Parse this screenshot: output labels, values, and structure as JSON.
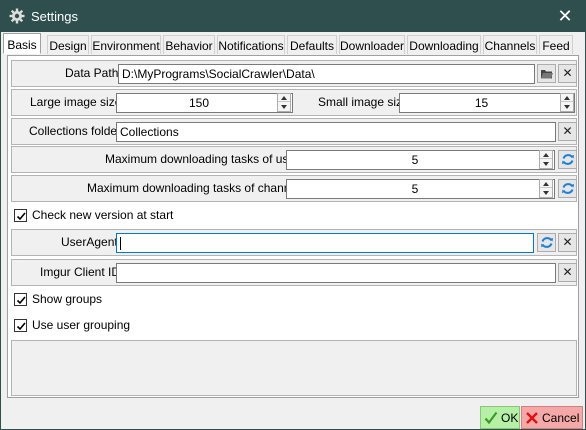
{
  "window": {
    "title": "Settings",
    "close_glyph": "✕"
  },
  "tabs": [
    {
      "label": "Basis"
    },
    {
      "label": "Design"
    },
    {
      "label": "Environment"
    },
    {
      "label": "Behavior"
    },
    {
      "label": "Notifications"
    },
    {
      "label": "Defaults"
    },
    {
      "label": "Downloader"
    },
    {
      "label": "Downloading"
    },
    {
      "label": "Channels"
    },
    {
      "label": "Feed"
    }
  ],
  "form": {
    "data_path": {
      "label": "Data Path",
      "value": "D:\\MyPrograms\\SocialCrawler\\Data\\"
    },
    "large_image": {
      "label": "Large image size",
      "value": "150"
    },
    "small_image": {
      "label": "Small image size",
      "value": "15"
    },
    "collections": {
      "label": "Collections folder",
      "value": "Collections"
    },
    "max_users": {
      "label": "Maximum downloading tasks of users",
      "value": "5"
    },
    "max_channels": {
      "label": "Maximum downloading tasks of channels",
      "value": "5"
    },
    "check_version": {
      "label": "Check new version at start",
      "checked": true
    },
    "user_agent": {
      "label": "UserAgent",
      "value": ""
    },
    "imgur": {
      "label": "Imgur Client ID",
      "value": ""
    },
    "show_groups": {
      "label": "Show groups",
      "checked": true
    },
    "user_grouping": {
      "label": "Use user grouping",
      "checked": true
    }
  },
  "buttons": {
    "clear_glyph": "✕",
    "ok": "OK",
    "cancel": "Cancel"
  },
  "colors": {
    "titlebar": "#2f4f4f",
    "ok_bg": "#b6f0a6",
    "cancel_bg": "#f5a8a8",
    "refresh": "#1e7fd6"
  },
  "icons": {
    "title": "gear-icon",
    "open": "folder-open-icon",
    "clear": "clear-icon",
    "refresh": "refresh-icon",
    "ok": "checkmark-icon",
    "cancel": "cancel-icon"
  }
}
